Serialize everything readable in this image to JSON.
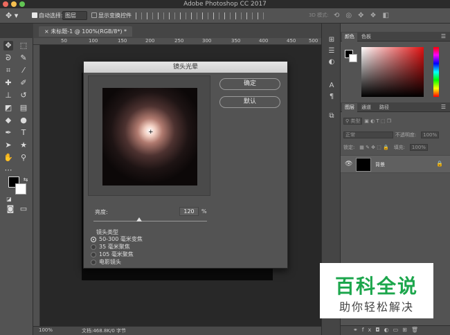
{
  "app": {
    "title": "Adobe Photoshop CC 2017"
  },
  "options_bar": {
    "auto_select_label": "自动选择:",
    "auto_select_value": "图层",
    "show_transform_label": "显示变换控件",
    "mode_3d_label": "3D 模式:"
  },
  "document": {
    "tab_label": "未标题-1 @ 100%(RGB/8*) *",
    "ruler_numbers": [
      "50",
      "100",
      "150",
      "200",
      "250",
      "300",
      "350",
      "400",
      "450",
      "500"
    ],
    "zoom": "100%",
    "doc_size": "文档:468.8K/0 字节"
  },
  "dialog": {
    "title": "镜头光晕",
    "ok_label": "确定",
    "default_label": "默认",
    "brightness_label": "亮度:",
    "brightness_value": "120",
    "brightness_unit": "%",
    "brightness_fraction": 0.4,
    "lens_type_label": "镜头类型",
    "lens_options": [
      {
        "label": "50-300 毫米变焦",
        "selected": true
      },
      {
        "label": "35 毫米聚焦",
        "selected": false
      },
      {
        "label": "105 毫米聚焦",
        "selected": false
      },
      {
        "label": "电影镜头",
        "selected": false
      }
    ]
  },
  "panels": {
    "color_tabs": [
      "颜色",
      "色板"
    ],
    "layer_tabs": [
      "图层",
      "通道",
      "路径"
    ],
    "layer_filter": "类型",
    "blend_mode": "正常",
    "opacity_label": "不透明度:",
    "opacity_value": "100%",
    "lock_label": "锁定:",
    "fill_label": "填充:",
    "fill_value": "100%",
    "layer_name": "背景"
  },
  "watermark": {
    "main": "百科全说",
    "sub": "助你轻松解决"
  },
  "colors": {
    "foreground": "#000000",
    "background": "#ffffff",
    "watermark_green": "#1ca64c"
  }
}
